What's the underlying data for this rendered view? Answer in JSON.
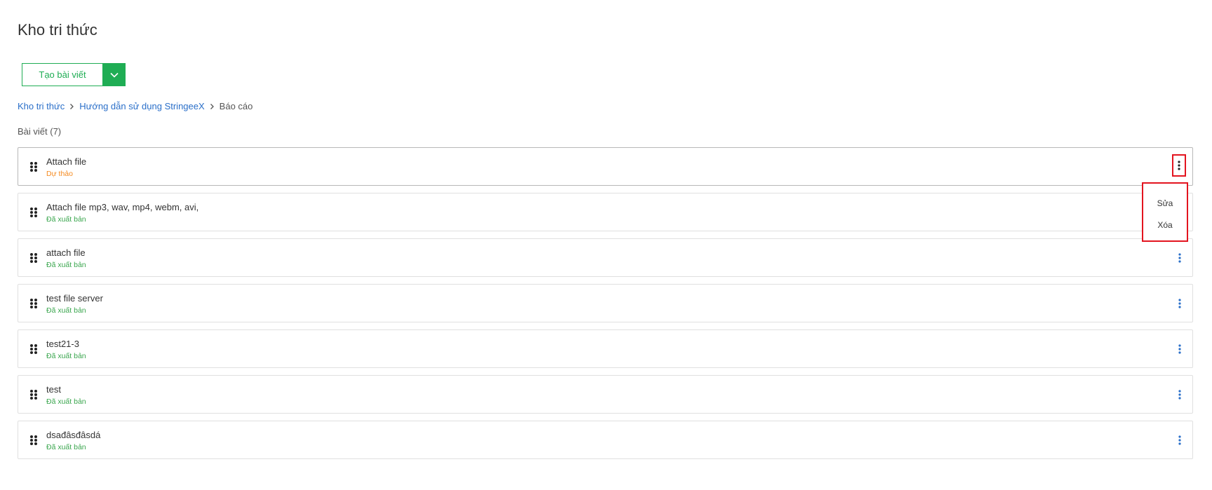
{
  "page": {
    "title": "Kho tri thức"
  },
  "toolbar": {
    "create_label": "Tạo bài viết"
  },
  "breadcrumb": {
    "items": [
      "Kho tri thức",
      "Hướng dẫn sử dụng StringeeX"
    ],
    "current": "Báo cáo"
  },
  "articles": {
    "count_label": "Bài viết (7)",
    "rows": [
      {
        "title": "Attach file",
        "status": "Dự thảo"
      },
      {
        "title": "Attach file mp3, wav, mp4, webm, avi,",
        "status": "Đã xuất bản"
      },
      {
        "title": "attach file",
        "status": "Đã xuất bản"
      },
      {
        "title": "test file server",
        "status": "Đã xuất bản"
      },
      {
        "title": "test21-3",
        "status": "Đã xuất bản"
      },
      {
        "title": "test",
        "status": "Đã xuất bản"
      },
      {
        "title": "dsađâsđâsdá",
        "status": "Đã xuất bản"
      }
    ]
  },
  "context_menu": {
    "edit_label": "Sửa",
    "delete_label": "Xóa"
  },
  "colors": {
    "accent_green": "#1fad54",
    "link_blue": "#2a6fc9",
    "draft_orange": "#f58a1f",
    "published_green": "#3aa64e",
    "highlight_red": "#e3141f"
  },
  "icons": {
    "caret": "chevron-down-icon",
    "breadcrumb_separator": "chevron-right-icon",
    "drag_handle": "drag-handle-icon",
    "row_menu": "more-vertical-icon"
  }
}
